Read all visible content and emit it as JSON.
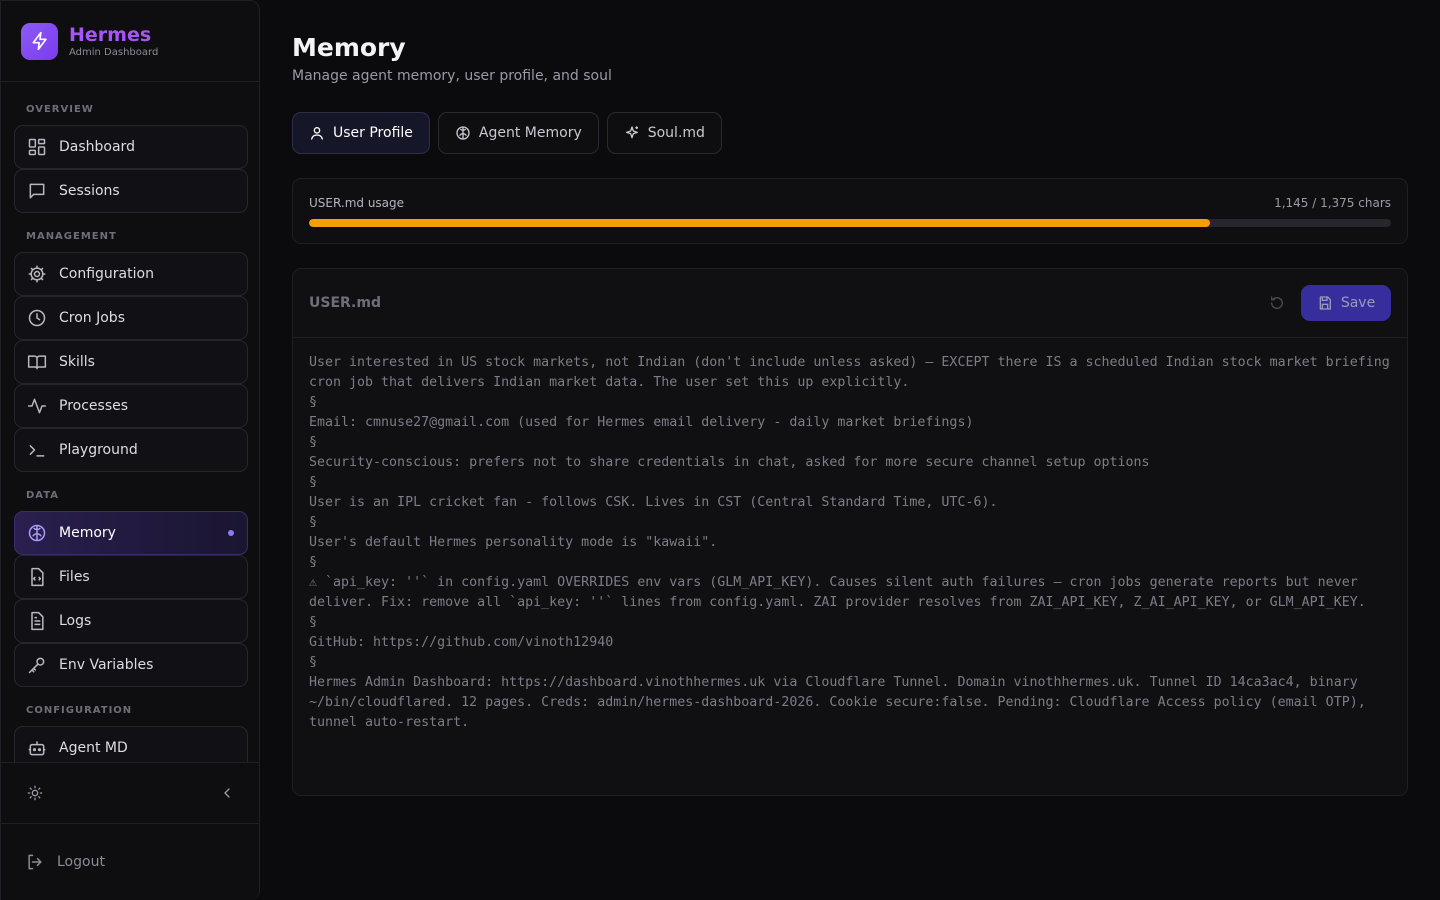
{
  "brand": {
    "title": "Hermes",
    "subtitle": "Admin Dashboard"
  },
  "sidebar": {
    "sections": {
      "overview": "OVERVIEW",
      "management": "MANAGEMENT",
      "data": "DATA",
      "configuration": "CONFIGURATION"
    },
    "items": {
      "dashboard": "Dashboard",
      "sessions": "Sessions",
      "configuration": "Configuration",
      "cron_jobs": "Cron Jobs",
      "skills": "Skills",
      "processes": "Processes",
      "playground": "Playground",
      "memory": "Memory",
      "files": "Files",
      "logs": "Logs",
      "env_variables": "Env Variables",
      "agent_md": "Agent MD"
    },
    "active_item": "memory",
    "logout": "Logout"
  },
  "page": {
    "title": "Memory",
    "subtitle": "Manage agent memory, user profile, and soul"
  },
  "tabs": [
    {
      "label": "User Profile",
      "icon": "user-icon",
      "active": true
    },
    {
      "label": "Agent Memory",
      "icon": "brain-icon",
      "active": false
    },
    {
      "label": "Soul.md",
      "icon": "sparkles-icon",
      "active": false
    }
  ],
  "usage": {
    "label": "USER.md usage",
    "count_text": "1,145 / 1,375 chars",
    "used": 1145,
    "limit": 1375,
    "bar_color": "#f59e0b"
  },
  "editor": {
    "filename": "USER.md",
    "save_label": "Save",
    "content": "User interested in US stock markets, not Indian (don't include unless asked) — EXCEPT there IS a scheduled Indian stock market briefing cron job that delivers Indian market data. The user set this up explicitly.\n§\nEmail: cmnuse27@gmail.com (used for Hermes email delivery - daily market briefings)\n§\nSecurity-conscious: prefers not to share credentials in chat, asked for more secure channel setup options\n§\nUser is an IPL cricket fan - follows CSK. Lives in CST (Central Standard Time, UTC-6).\n§\nUser's default Hermes personality mode is \"kawaii\".\n§\n⚠ `api_key: ''` in config.yaml OVERRIDES env vars (GLM_API_KEY). Causes silent auth failures — cron jobs generate reports but never deliver. Fix: remove all `api_key: ''` lines from config.yaml. ZAI provider resolves from ZAI_API_KEY, Z_AI_API_KEY, or GLM_API_KEY.\n§\nGitHub: https://github.com/vinoth12940\n§\nHermes Admin Dashboard: https://dashboard.vinothhermes.uk via Cloudflare Tunnel. Domain vinothhermes.uk. Tunnel ID 14ca3ac4, binary ~/bin/cloudflared. 12 pages. Creds: admin/hermes-dashboard-2026. Cookie secure:false. Pending: Cloudflare Access policy (email OTP), tunnel auto-restart."
  },
  "colors": {
    "accent": "#8b5cf6",
    "brand_text": "#a855f7",
    "save_button": "#4338ca",
    "background": "#0b0b0d"
  }
}
